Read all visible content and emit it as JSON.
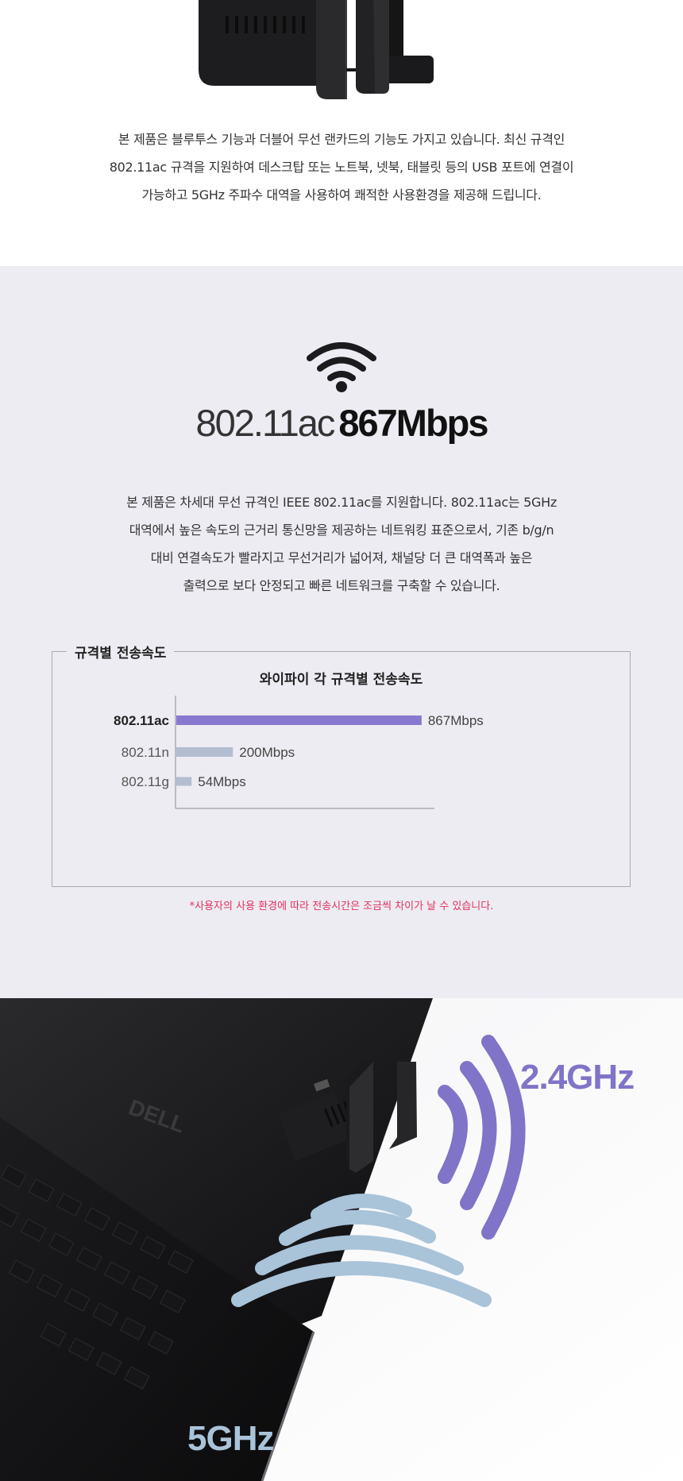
{
  "intro": {
    "lines": [
      "본 제품은 블루투스 기능과 더블어 무선 랜카드의 기능도 가지고 있습니다. 최신 규격인",
      "802.11ac 규격을 지원하여 데스크탑 또는 노트북, 넷북, 태블릿 등의 USB 포트에 연결이",
      "가능하고 5GHz 주파수 대역을 사용하여 쾌적한 사용환경을 제공해 드립니다."
    ]
  },
  "spec": {
    "title_light": "802.11ac",
    "title_bold": "867Mbps",
    "lines": [
      "본 제품은 차세대 무선 규격인 IEEE 802.11ac를 지원합니다. 802.11ac는 5GHz",
      "대역에서 높은 속도의 근거리 통신망을 제공하는 네트워킹 표준으로서, 기존 b/g/n",
      "대비 연결속도가 빨라지고 무선거리가 넓어져, 채널당 더 큰 대역폭과 높은",
      "출력으로 보다 안정되고 빠른 네트워크를 구축할 수 있습니다."
    ],
    "box_title": "규격별 전송속도",
    "note": "*사용자의 사용 환경에 따라 전송시간은 조금씩 차이가 날 수 있습니다."
  },
  "chart_data": {
    "type": "bar",
    "orientation": "horizontal",
    "title": "와이파이 각 규격별 전송속도",
    "categories": [
      "802.11ac",
      "802.11n",
      "802.11g"
    ],
    "values": [
      867,
      200,
      54
    ],
    "value_labels": [
      "867Mbps",
      "200Mbps",
      "54Mbps"
    ],
    "unit": "Mbps",
    "colors": [
      "#8878d0",
      "#b3bdd0",
      "#b3bdd0"
    ],
    "xlim": [
      0,
      950
    ],
    "grid": false,
    "legend": "none"
  },
  "scene": {
    "label_24": "2.4GHz",
    "label_5": "5GHz",
    "color_24": "#8074c8",
    "color_5": "#a9c3d9"
  }
}
